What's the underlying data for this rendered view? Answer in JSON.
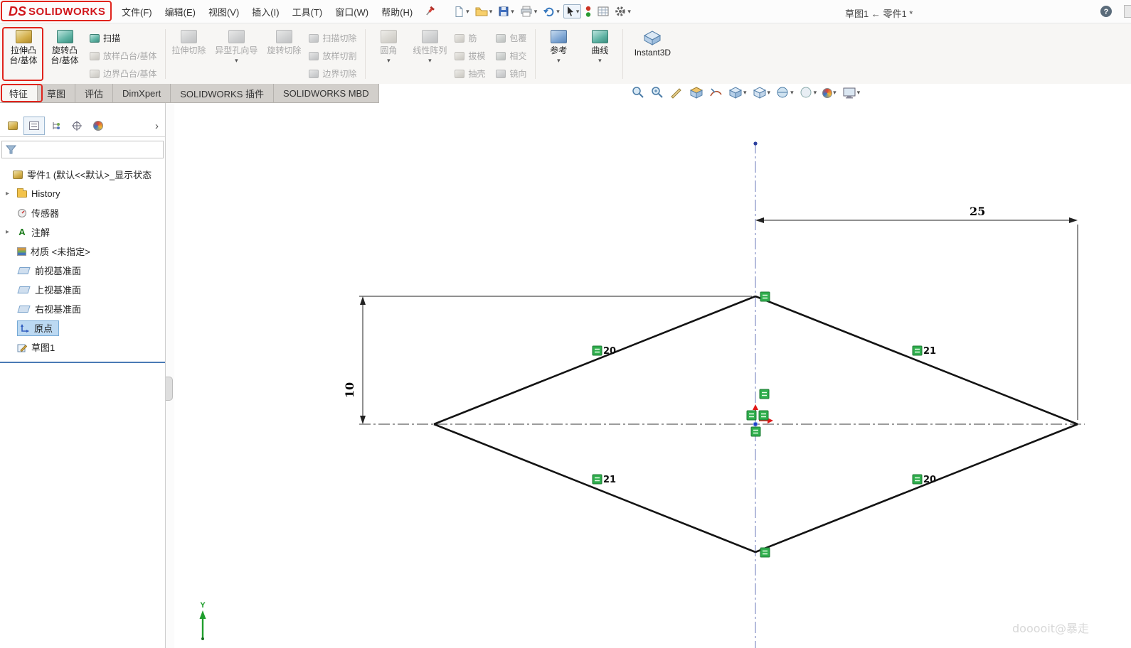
{
  "menubar": {
    "logo": {
      "mark": "DS",
      "text": "SOLIDWORKS"
    },
    "menus": [
      "文件(F)",
      "编辑(E)",
      "视图(V)",
      "插入(I)",
      "工具(T)",
      "窗口(W)",
      "帮助(H)"
    ],
    "doc_title": "草图1 ← 零件1 *",
    "help": "?"
  },
  "ribbon": {
    "buttons": {
      "extrude_boss": "拉伸凸台/基体",
      "revolve_boss": "旋转凸台/基体",
      "sweep": "扫描",
      "loft": "放样凸台/基体",
      "boundary_boss": "边界凸台/基体",
      "extrude_cut": "拉伸切除",
      "hole_wizard": "异型孔向导",
      "revolve_cut": "旋转切除",
      "sweep_cut": "扫描切除",
      "loft_cut": "放样切割",
      "boundary_cut": "边界切除",
      "fillet": "圆角",
      "linear_pattern": "线性阵列",
      "rib": "筋",
      "draft": "拔模",
      "shell": "抽壳",
      "wrap": "包覆",
      "intersect": "相交",
      "mirror": "镜向",
      "reference": "参考",
      "curves": "曲线",
      "instant3d": "Instant3D"
    },
    "tabs": [
      "特征",
      "草图",
      "评估",
      "DimXpert",
      "SOLIDWORKS 插件",
      "SOLIDWORKS MBD"
    ]
  },
  "tree": {
    "root": "零件1 (默认<<默认>_显示状态",
    "items": [
      "History",
      "传感器",
      "注解",
      "材质 <未指定>",
      "前视基准面",
      "上视基准面",
      "右视基准面",
      "原点",
      "草图1"
    ]
  },
  "sketch": {
    "dim_width": "25",
    "dim_height": "10",
    "labels": {
      "tl": "20",
      "tr": "21",
      "bl": "21",
      "br": "20"
    },
    "axis_y": "Y"
  },
  "watermark": "dooooit@暴走",
  "colors": {
    "accent_red": "#e0241c",
    "constraint_green": "#2fae4d",
    "select_blue": "#bcd9f2"
  }
}
